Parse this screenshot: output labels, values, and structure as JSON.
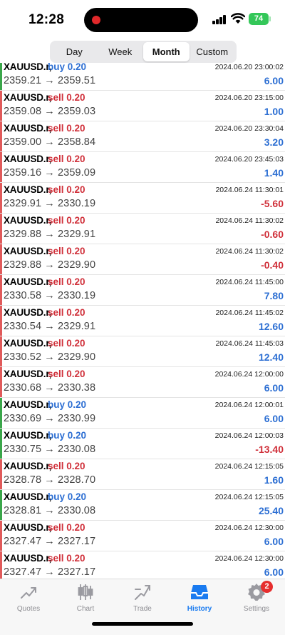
{
  "status": {
    "time": "12:28",
    "battery": "74"
  },
  "periods": [
    "Day",
    "Week",
    "Month",
    "Custom"
  ],
  "active_period": 2,
  "deals": [
    {
      "symbol": "XAUUSD.r,",
      "side": "buy",
      "volume": "buy 0.20",
      "open": "2359.21",
      "close": "2359.51",
      "time": "2024.06.20 23:00:02",
      "profit": "6.00"
    },
    {
      "symbol": "XAUUSD.r,",
      "side": "sell",
      "volume": "sell 0.20",
      "open": "2359.08",
      "close": "2359.03",
      "time": "2024.06.20 23:15:00",
      "profit": "1.00"
    },
    {
      "symbol": "XAUUSD.r,",
      "side": "sell",
      "volume": "sell 0.20",
      "open": "2359.00",
      "close": "2358.84",
      "time": "2024.06.20 23:30:04",
      "profit": "3.20"
    },
    {
      "symbol": "XAUUSD.r,",
      "side": "sell",
      "volume": "sell 0.20",
      "open": "2359.16",
      "close": "2359.09",
      "time": "2024.06.20 23:45:03",
      "profit": "1.40"
    },
    {
      "symbol": "XAUUSD.r,",
      "side": "sell",
      "volume": "sell 0.20",
      "open": "2329.91",
      "close": "2330.19",
      "time": "2024.06.24 11:30:01",
      "profit": "-5.60"
    },
    {
      "symbol": "XAUUSD.r,",
      "side": "sell",
      "volume": "sell 0.20",
      "open": "2329.88",
      "close": "2329.91",
      "time": "2024.06.24 11:30:02",
      "profit": "-0.60"
    },
    {
      "symbol": "XAUUSD.r,",
      "side": "sell",
      "volume": "sell 0.20",
      "open": "2329.88",
      "close": "2329.90",
      "time": "2024.06.24 11:30:02",
      "profit": "-0.40"
    },
    {
      "symbol": "XAUUSD.r,",
      "side": "sell",
      "volume": "sell 0.20",
      "open": "2330.58",
      "close": "2330.19",
      "time": "2024.06.24 11:45:00",
      "profit": "7.80"
    },
    {
      "symbol": "XAUUSD.r,",
      "side": "sell",
      "volume": "sell 0.20",
      "open": "2330.54",
      "close": "2329.91",
      "time": "2024.06.24 11:45:02",
      "profit": "12.60"
    },
    {
      "symbol": "XAUUSD.r,",
      "side": "sell",
      "volume": "sell 0.20",
      "open": "2330.52",
      "close": "2329.90",
      "time": "2024.06.24 11:45:03",
      "profit": "12.40"
    },
    {
      "symbol": "XAUUSD.r,",
      "side": "sell",
      "volume": "sell 0.20",
      "open": "2330.68",
      "close": "2330.38",
      "time": "2024.06.24 12:00:00",
      "profit": "6.00"
    },
    {
      "symbol": "XAUUSD.r,",
      "side": "buy",
      "volume": "buy 0.20",
      "open": "2330.69",
      "close": "2330.99",
      "time": "2024.06.24 12:00:01",
      "profit": "6.00"
    },
    {
      "symbol": "XAUUSD.r,",
      "side": "buy",
      "volume": "buy 0.20",
      "open": "2330.75",
      "close": "2330.08",
      "time": "2024.06.24 12:00:03",
      "profit": "-13.40"
    },
    {
      "symbol": "XAUUSD.r,",
      "side": "sell",
      "volume": "sell 0.20",
      "open": "2328.78",
      "close": "2328.70",
      "time": "2024.06.24 12:15:05",
      "profit": "1.60"
    },
    {
      "symbol": "XAUUSD.r,",
      "side": "buy",
      "volume": "buy 0.20",
      "open": "2328.81",
      "close": "2330.08",
      "time": "2024.06.24 12:15:05",
      "profit": "25.40"
    },
    {
      "symbol": "XAUUSD.r,",
      "side": "sell",
      "volume": "sell 0.20",
      "open": "2327.47",
      "close": "2327.17",
      "time": "2024.06.24 12:30:00",
      "profit": "6.00"
    },
    {
      "symbol": "XAUUSD.r,",
      "side": "sell",
      "volume": "sell 0.20",
      "open": "2327.47",
      "close": "2327.17",
      "time": "2024.06.24 12:30:00",
      "profit": "6.00"
    }
  ],
  "tabs": [
    {
      "label": "Quotes",
      "icon": "quotes-icon"
    },
    {
      "label": "Chart",
      "icon": "candlestick-chart-icon"
    },
    {
      "label": "Trade",
      "icon": "trade-icon"
    },
    {
      "label": "History",
      "icon": "history-inbox-icon"
    },
    {
      "label": "Settings",
      "icon": "gear-icon",
      "badge": "2"
    }
  ],
  "active_tab": 3,
  "colors": {
    "sell": "#d0303a",
    "buy": "#2d6fd3",
    "accent": "#1a7bf0",
    "sell_bar": "#e05a5a",
    "buy_bar": "#3aa64a"
  }
}
